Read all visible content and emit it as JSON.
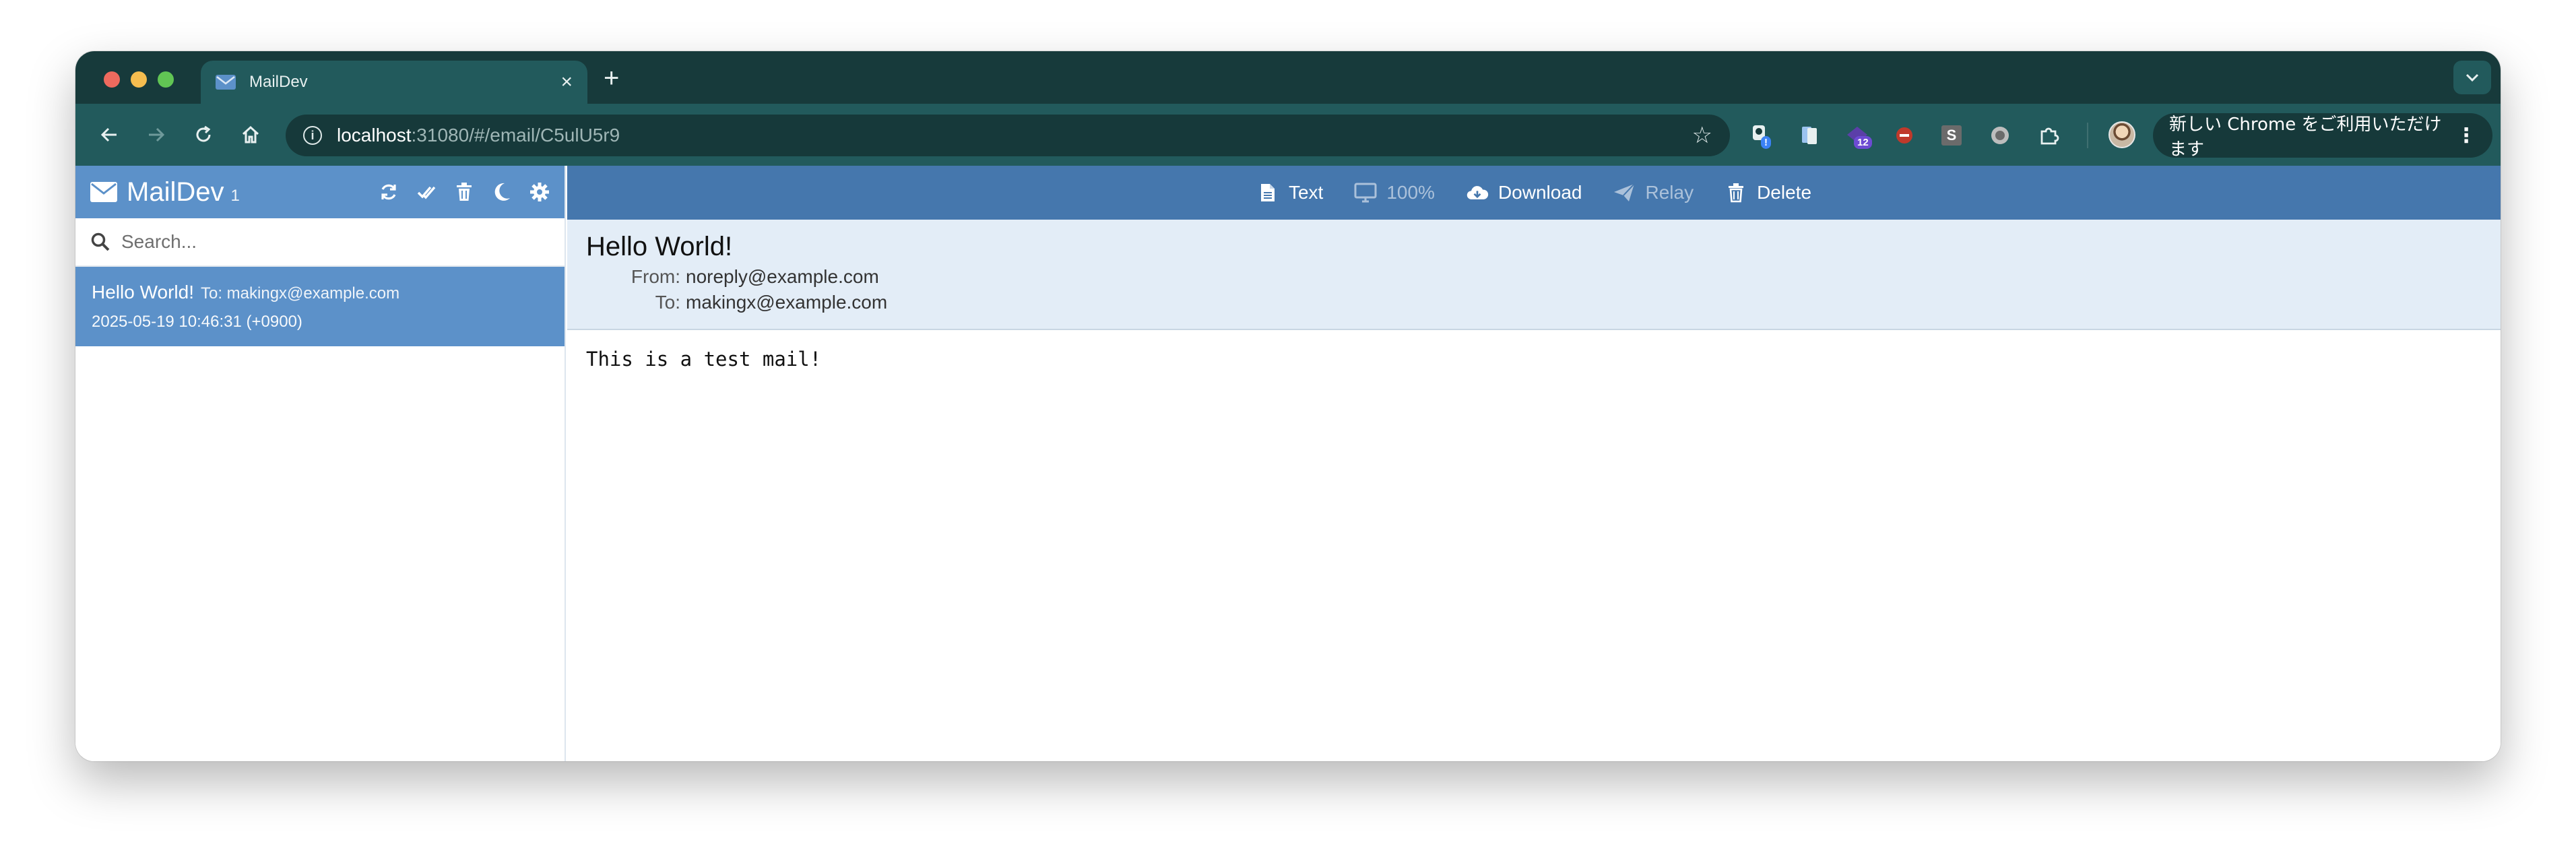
{
  "browser": {
    "tab_title": "MailDev",
    "new_tab_label": "+",
    "url_host": "localhost",
    "url_path": ":31080/#/email/C5ulU5r9",
    "chrome_promo": "新しい Chrome をご利用いただけます",
    "extensions": [
      {
        "icon": "extension-badge-icon",
        "badge": "!"
      },
      {
        "icon": "bookmark-ext-icon",
        "badge": ""
      },
      {
        "icon": "ext-purple-icon",
        "badge": "12"
      },
      {
        "icon": "block-icon",
        "badge": ""
      },
      {
        "icon": "s-ext-icon",
        "label": "S"
      },
      {
        "icon": "circle-ext-icon",
        "badge": ""
      },
      {
        "icon": "puzzle-icon",
        "badge": ""
      }
    ]
  },
  "sidebar": {
    "brand": "MailDev",
    "unread_count": "1",
    "search_placeholder": "Search...",
    "emails": [
      {
        "subject": "Hello World!",
        "to": "To: makingx@example.com",
        "date": "2025-05-19 10:46:31 (+0900)"
      }
    ]
  },
  "toolbar": {
    "text_label": "Text",
    "zoom_label": "100%",
    "download_label": "Download",
    "relay_label": "Relay",
    "delete_label": "Delete"
  },
  "email": {
    "subject": "Hello World!",
    "from_label": "From:",
    "from": "noreply@example.com",
    "to_label": "To:",
    "to": "makingx@example.com",
    "body": "This is a test mail!"
  },
  "colors": {
    "sidebar_header": "#5c91c9",
    "toolbar": "#4577ad",
    "header_bg": "#e3edf7",
    "chrome_dark": "#173a3b",
    "chrome_tab": "#225a5c"
  }
}
